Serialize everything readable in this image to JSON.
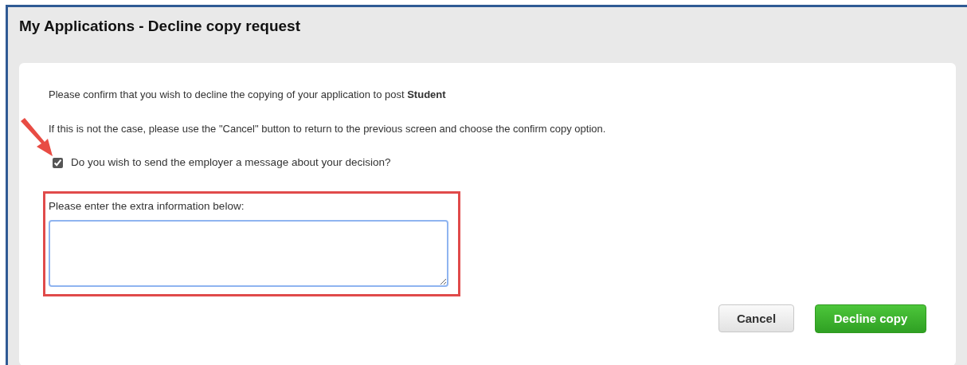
{
  "title": "My Applications - Decline copy request",
  "paragraphs": [
    "Please confirm that you wish to decline the copying of your application to post **Student**",
    "If this is not the case, please use the \"Cancel\" button to return to the previous screen and choose the confirm copy option."
  ],
  "send_message": {
    "label": "Do you wish to send the employer a message about your decision?",
    "checked": true
  },
  "extra_info": {
    "label": "Please enter the extra information below:",
    "focused": true
  },
  "buttons": [
    {
      "label": "Cancel",
      "kind": "secondary"
    },
    {
      "label": "Decline copy",
      "kind": "primary"
    }
  ]
}
